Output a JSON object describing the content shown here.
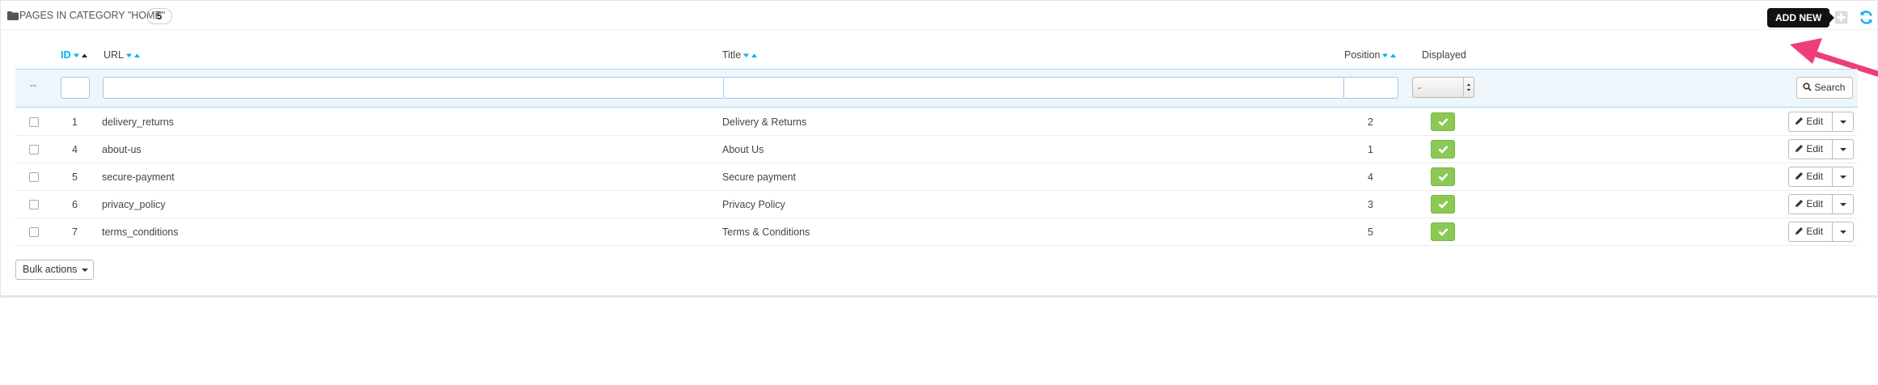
{
  "header": {
    "title": "PAGES IN CATEGORY \"HOME\"",
    "count": "5",
    "tooltip": "ADD NEW"
  },
  "columns": {
    "id": "ID",
    "url": "URL",
    "title": "Title",
    "position": "Position",
    "displayed": "Displayed"
  },
  "filters": {
    "bulk_placeholder": "--",
    "displayed_select": "-",
    "search_label": "Search"
  },
  "rows": [
    {
      "id": "1",
      "url": "delivery_returns",
      "title": "Delivery & Returns",
      "position": "2",
      "displayed": true
    },
    {
      "id": "4",
      "url": "about-us",
      "title": "About Us",
      "position": "1",
      "displayed": true
    },
    {
      "id": "5",
      "url": "secure-payment",
      "title": "Secure payment",
      "position": "4",
      "displayed": true
    },
    {
      "id": "6",
      "url": "privacy_policy",
      "title": "Privacy Policy",
      "position": "3",
      "displayed": true
    },
    {
      "id": "7",
      "url": "terms_conditions",
      "title": "Terms & Conditions",
      "position": "5",
      "displayed": true
    }
  ],
  "row_actions": {
    "edit_label": "Edit"
  },
  "footer": {
    "bulk_actions_label": "Bulk actions"
  },
  "icons": {
    "folder": "folder-icon",
    "add": "plus-icon",
    "refresh": "refresh-icon",
    "search": "search-icon",
    "edit": "pencil-icon",
    "displayed": "check-icon"
  },
  "colors": {
    "accent": "#00aff0",
    "enabled_green": "#8bc954",
    "tooltip_bg": "#111111",
    "annotation_arrow": "#ee3e77"
  }
}
